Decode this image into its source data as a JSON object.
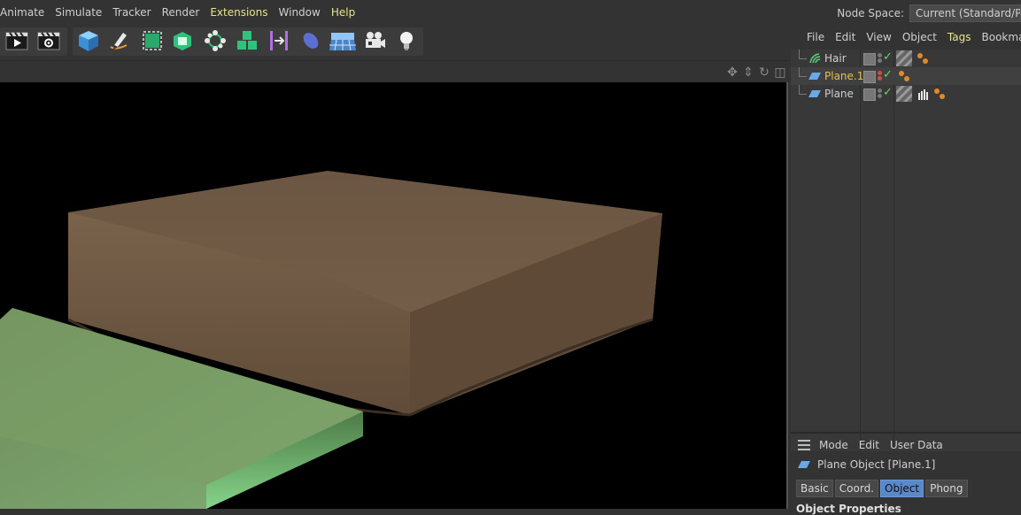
{
  "menubar": {
    "items": [
      {
        "label": "Animate",
        "highlight": false
      },
      {
        "label": "Simulate",
        "highlight": false
      },
      {
        "label": "Tracker",
        "highlight": false
      },
      {
        "label": "Render",
        "highlight": false
      },
      {
        "label": "Extensions",
        "highlight": true
      },
      {
        "label": "Window",
        "highlight": false
      },
      {
        "label": "Help",
        "highlight": true
      }
    ],
    "node_space_label": "Node Space:",
    "node_space_value": "Current (Standard/Physical)"
  },
  "toolbar": {
    "buttons": [
      "render-view-icon",
      "render-settings-icon",
      "cube-icon",
      "pen-icon",
      "subdivision-icon",
      "extrude-icon",
      "mograph-cloner-icon",
      "volume-icon",
      "deformer-icon",
      "field-icon",
      "floor-icon",
      "camera-icon",
      "light-icon"
    ]
  },
  "viewport": {
    "nav_icons": [
      "move-icon",
      "zoom-icon",
      "rotate-icon",
      "layout-icon"
    ]
  },
  "object_manager": {
    "menu": [
      {
        "label": "File",
        "highlight": false
      },
      {
        "label": "Edit",
        "highlight": false
      },
      {
        "label": "View",
        "highlight": false
      },
      {
        "label": "Object",
        "highlight": false
      },
      {
        "label": "Tags",
        "highlight": true
      },
      {
        "label": "Bookmarks",
        "highlight": false
      }
    ],
    "objects": [
      {
        "name": "Hair",
        "icon": "hair-icon",
        "name_color": "#cfcfcf",
        "tags": [
          "material-tag-icon",
          "hair-material-tag-icon"
        ]
      },
      {
        "name": "Plane.1",
        "icon": "plane-icon",
        "name_color": "#e8c04a",
        "tags": [
          "hair-material-tag-icon"
        ]
      },
      {
        "name": "Plane",
        "icon": "plane-icon",
        "name_color": "#cfcfcf",
        "tags": [
          "material-tag-icon",
          "touch-tag-icon",
          "hair-material-tag-icon"
        ]
      }
    ]
  },
  "attributes": {
    "menu": [
      "Mode",
      "Edit",
      "User Data"
    ],
    "title": "Plane Object [Plane.1]",
    "tabs": [
      {
        "label": "Basic",
        "active": false
      },
      {
        "label": "Coord.",
        "active": false
      },
      {
        "label": "Object",
        "active": true
      },
      {
        "label": "Phong",
        "active": false
      }
    ],
    "section": "Object Properties"
  },
  "colors": {
    "accent_yellow": "#e8e48a",
    "selected_name": "#e8c04a",
    "active_tab": "#5a88c8",
    "dirt_block": "#7a634c",
    "grass_block": "#6ea56a"
  }
}
